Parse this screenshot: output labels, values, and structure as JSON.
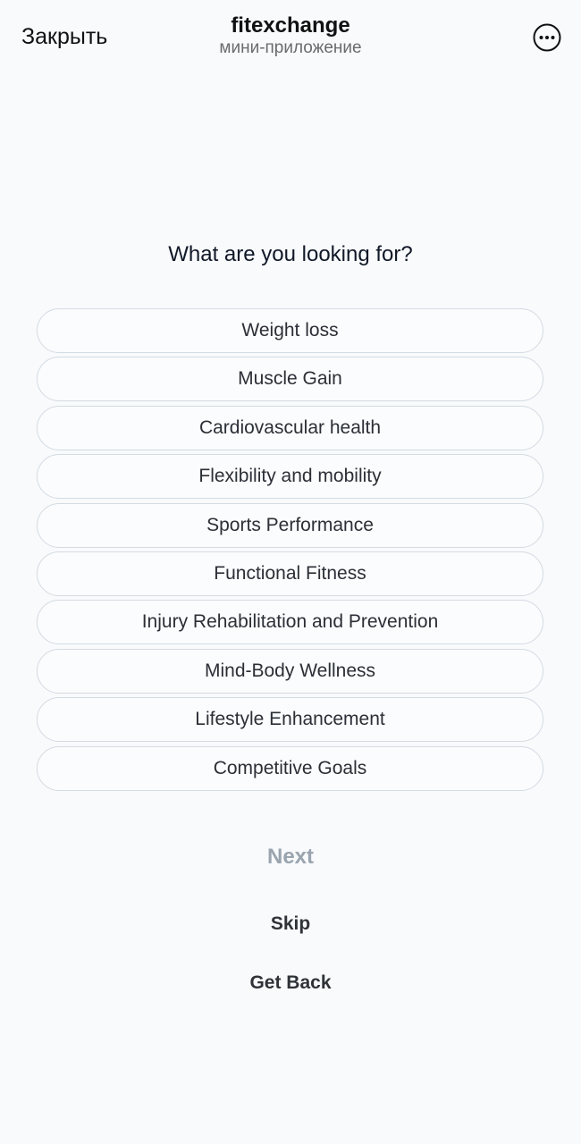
{
  "header": {
    "close_label": "Закрыть",
    "title": "fitexchange",
    "subtitle": "мини-приложение",
    "more_icon": "more-horizontal-circle-icon"
  },
  "main": {
    "question": "What are you looking for?",
    "options": [
      {
        "label": "Weight loss"
      },
      {
        "label": "Muscle Gain"
      },
      {
        "label": "Cardiovascular health"
      },
      {
        "label": "Flexibility and mobility"
      },
      {
        "label": "Sports Performance"
      },
      {
        "label": "Functional Fitness"
      },
      {
        "label": "Injury Rehabilitation and Prevention"
      },
      {
        "label": "Mind-Body Wellness"
      },
      {
        "label": "Lifestyle Enhancement"
      },
      {
        "label": "Competitive Goals"
      }
    ]
  },
  "actions": {
    "next_label": "Next",
    "skip_label": "Skip",
    "back_label": "Get Back"
  },
  "colors": {
    "background": "#f8fafc",
    "option_border": "#d3dbe3",
    "next_disabled": "#9aa4ae",
    "text_dark": "#2f3338"
  }
}
